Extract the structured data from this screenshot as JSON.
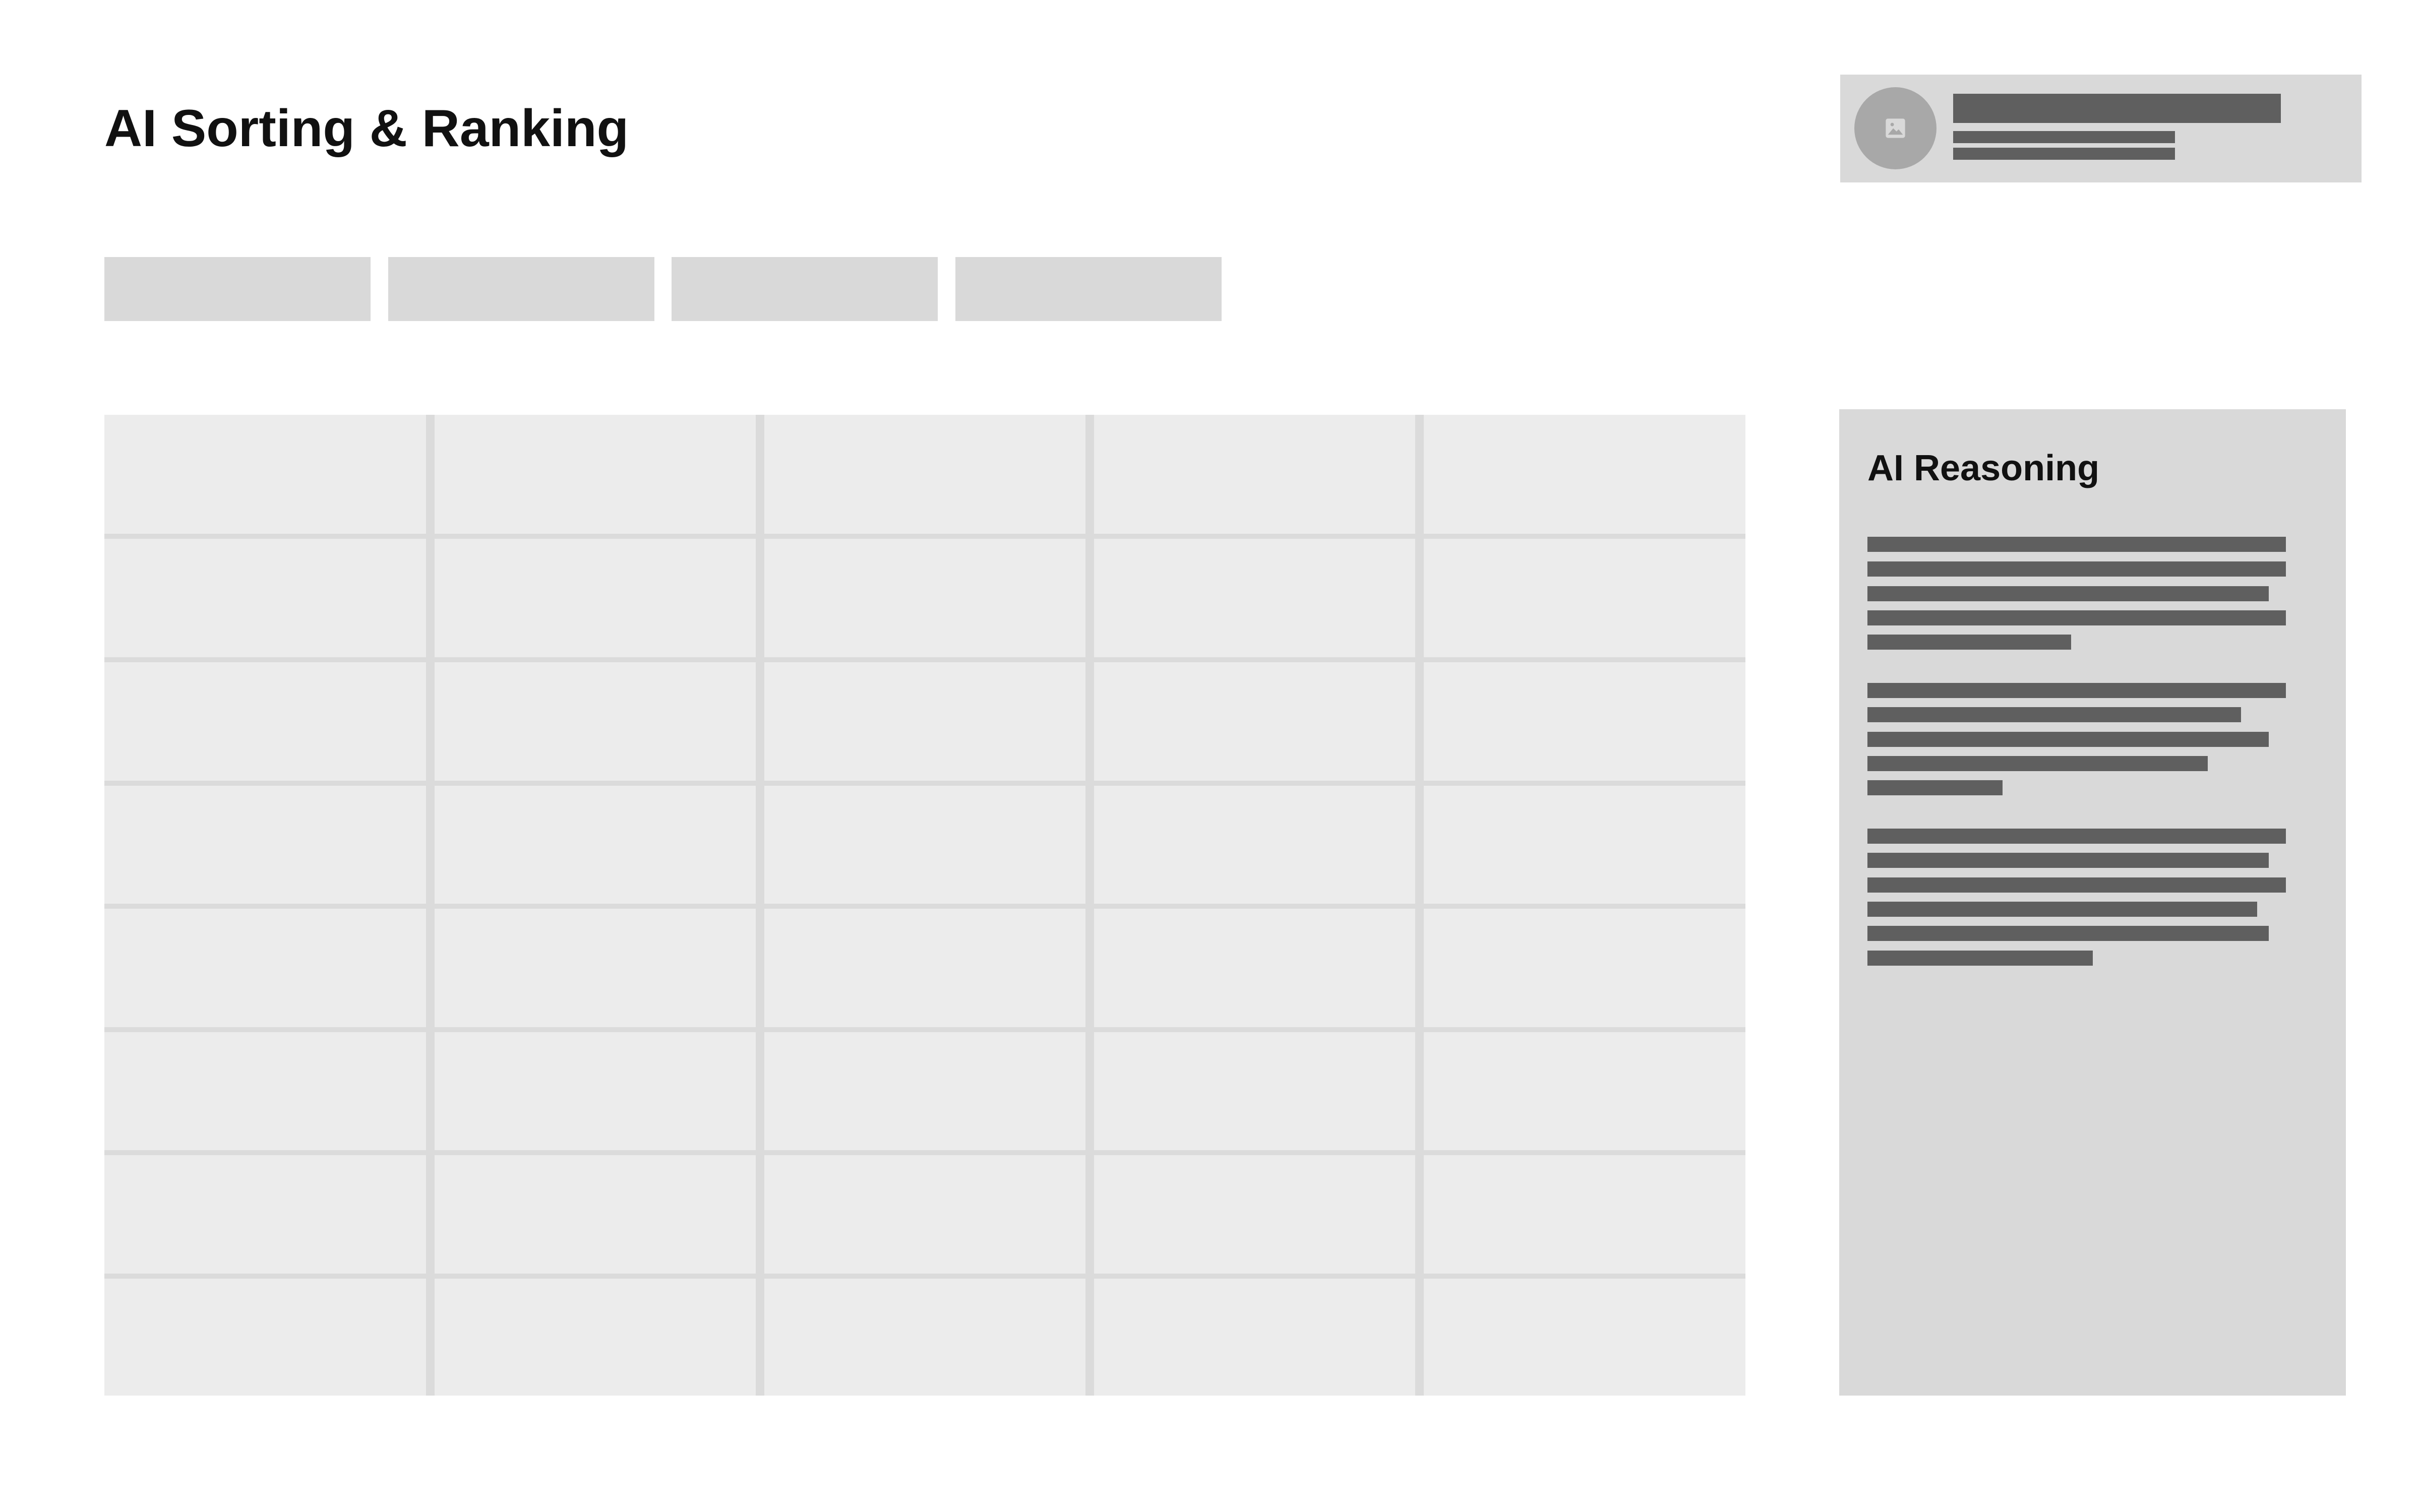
{
  "page": {
    "title": "AI Sorting & Ranking"
  },
  "profile": {
    "avatar_icon": "image-icon"
  },
  "filters": {
    "tabs": [
      {
        "id": "tab-1"
      },
      {
        "id": "tab-2"
      },
      {
        "id": "tab-3"
      },
      {
        "id": "tab-4"
      }
    ]
  },
  "table": {
    "rows": 8,
    "columns": 5
  },
  "reasoning": {
    "title": "AI Reasoning"
  },
  "colors": {
    "background": "#ffffff",
    "placeholder": "#d9d9d9",
    "table_fill": "#ececec",
    "table_grid": "#dbdbdb",
    "text_placeholder": "#5f5f5f",
    "avatar": "#a8a8a8"
  }
}
